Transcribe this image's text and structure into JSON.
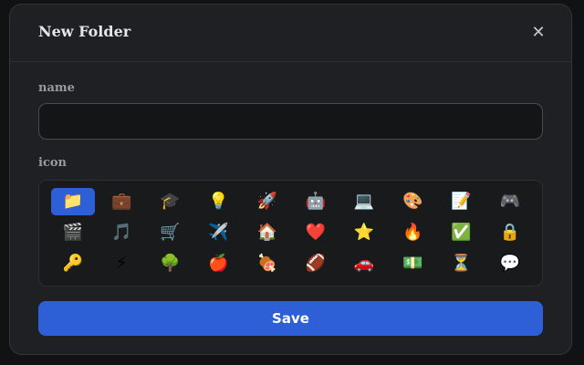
{
  "modal": {
    "title": "New Folder",
    "close_glyph": "✕",
    "close_icon": "close-icon"
  },
  "name_field": {
    "label": "name",
    "value": "",
    "placeholder": ""
  },
  "icon_field": {
    "label": "icon",
    "selected_index": 0,
    "icons": [
      {
        "glyph": "📁",
        "name": "folder-icon"
      },
      {
        "glyph": "💼",
        "name": "briefcase-icon"
      },
      {
        "glyph": "🎓",
        "name": "graduation-cap-icon"
      },
      {
        "glyph": "💡",
        "name": "lightbulb-icon"
      },
      {
        "glyph": "🚀",
        "name": "rocket-icon"
      },
      {
        "glyph": "🤖",
        "name": "robot-icon"
      },
      {
        "glyph": "💻",
        "name": "laptop-icon"
      },
      {
        "glyph": "🎨",
        "name": "palette-icon"
      },
      {
        "glyph": "📝",
        "name": "memo-icon"
      },
      {
        "glyph": "🎮",
        "name": "game-controller-icon"
      },
      {
        "glyph": "🎬",
        "name": "clapper-board-icon"
      },
      {
        "glyph": "🎵",
        "name": "music-note-icon"
      },
      {
        "glyph": "🛒",
        "name": "shopping-cart-icon"
      },
      {
        "glyph": "✈️",
        "name": "airplane-icon"
      },
      {
        "glyph": "🏠",
        "name": "house-icon"
      },
      {
        "glyph": "❤️",
        "name": "heart-icon"
      },
      {
        "glyph": "⭐",
        "name": "star-icon"
      },
      {
        "glyph": "🔥",
        "name": "fire-icon"
      },
      {
        "glyph": "✅",
        "name": "check-mark-icon"
      },
      {
        "glyph": "🔒",
        "name": "lock-icon"
      },
      {
        "glyph": "🔑",
        "name": "key-icon"
      },
      {
        "glyph": "⚡",
        "name": "lightning-icon"
      },
      {
        "glyph": "🌳",
        "name": "tree-icon"
      },
      {
        "glyph": "🍎",
        "name": "apple-icon"
      },
      {
        "glyph": "🍖",
        "name": "meat-icon"
      },
      {
        "glyph": "🏈",
        "name": "football-icon"
      },
      {
        "glyph": "🚗",
        "name": "car-icon"
      },
      {
        "glyph": "💵",
        "name": "money-icon"
      },
      {
        "glyph": "⏳",
        "name": "hourglass-icon"
      },
      {
        "glyph": "💬",
        "name": "speech-bubble-icon"
      }
    ]
  },
  "actions": {
    "save_label": "Save"
  },
  "colors": {
    "accent": "#2f5fd6",
    "modal_bg": "#1f2023",
    "input_bg": "#141517"
  }
}
